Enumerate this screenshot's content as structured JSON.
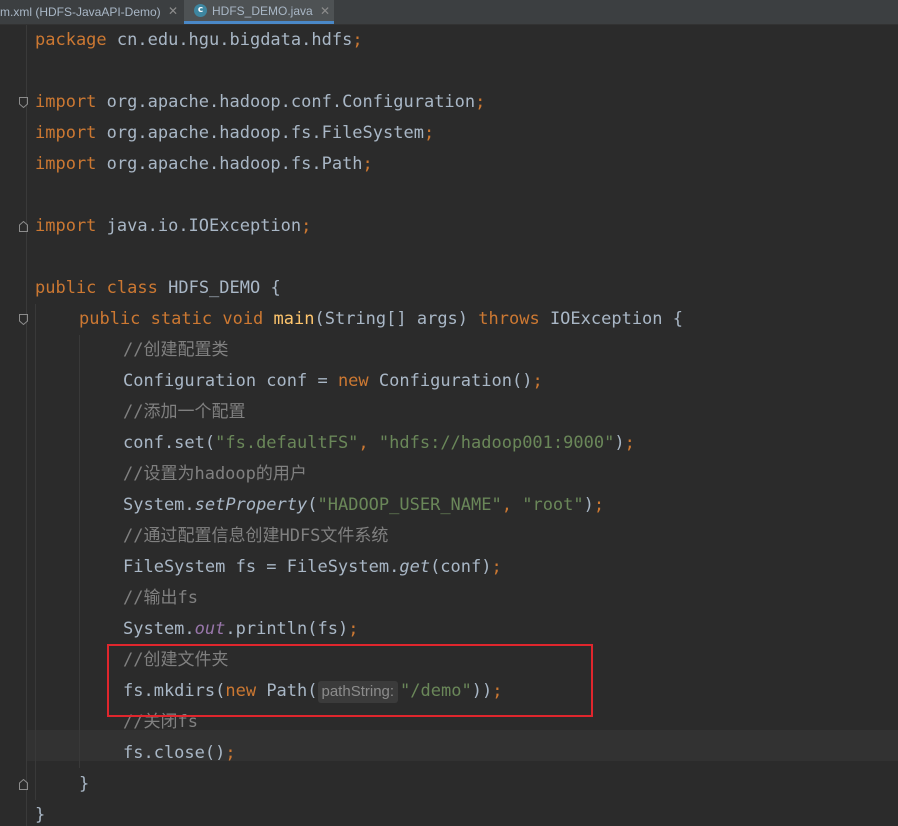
{
  "tabs": [
    {
      "label": "m.xml (HDFS-JavaAPI-Demo)",
      "active": false
    },
    {
      "label": "HDFS_DEMO.java",
      "active": true,
      "icon": "java-class-icon"
    }
  ],
  "code": {
    "package_kw": "package",
    "package_name": "cn.edu.hgu.bigdata.hdfs",
    "import_kw": "import",
    "import1": "org.apache.hadoop.conf.Configuration",
    "import2": "org.apache.hadoop.fs.FileSystem",
    "import3": "org.apache.hadoop.fs.Path",
    "import4": "java.io.IOException",
    "public_kw": "public",
    "class_kw": "class",
    "class_name": "HDFS_DEMO",
    "static_kw": "static",
    "void_kw": "void",
    "main_name": "main",
    "main_params": "(String[] args) ",
    "throws_kw": "throws",
    "exception": "IOException",
    "comment1": "//创建配置类",
    "conf_decl": "Configuration conf = ",
    "new_kw": "new",
    "conf_ctor": "Configuration()",
    "comment2": "//添加一个配置",
    "conf_set": "conf.set(",
    "str_fs_key": "\"fs.defaultFS\"",
    "str_fs_val": "\"hdfs://hadoop001:9000\"",
    "comment3": "//设置为hadoop的用户",
    "sys_prefix": "System.",
    "set_property": "setProperty",
    "str_user_key": "\"HADOOP_USER_NAME\"",
    "str_user_val": "\"root\"",
    "comment4": "//通过配置信息创建HDFS文件系统",
    "fs_decl": "FileSystem fs = FileSystem.",
    "get_method": "get",
    "fs_decl_tail": "(conf)",
    "comment5": "//输出fs",
    "out_field": "out",
    "println": ".println(fs)",
    "comment6": "//创建文件夹",
    "mkdirs_prefix": "fs.mkdirs(",
    "path_ctor": " Path(",
    "param_hint": "pathString:",
    "str_demo": "\"/demo\"",
    "comment7": "//关闭fs",
    "close_call": "fs.close()"
  }
}
